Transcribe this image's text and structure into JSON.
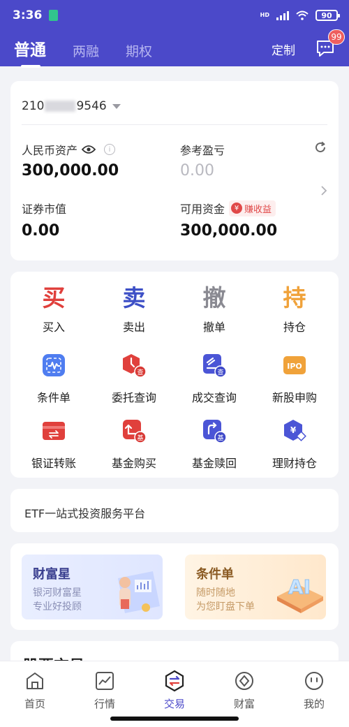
{
  "status_bar": {
    "time": "3:36",
    "network": "HD",
    "battery": "90"
  },
  "header": {
    "tabs": [
      {
        "label": "普通",
        "active": true
      },
      {
        "label": "两融",
        "active": false
      },
      {
        "label": "期权",
        "active": false
      }
    ],
    "customize_label": "定制",
    "message_badge": "99"
  },
  "account": {
    "number_prefix": "210",
    "number_suffix": "9546",
    "rmb_assets_label": "人民币资产",
    "rmb_assets_value": "300,000.00",
    "ref_pnl_label": "参考盈亏",
    "ref_pnl_value": "0.00",
    "securities_value_label": "证券市值",
    "securities_value": "0.00",
    "available_funds_label": "可用资金",
    "available_funds_value": "300,000.00",
    "earn_badge_label": "赚收益",
    "earn_badge_icon": "¥"
  },
  "trade_actions": [
    {
      "char": "买",
      "label": "买入",
      "color": "#e0403c"
    },
    {
      "char": "卖",
      "label": "卖出",
      "color": "#3d4fc6"
    },
    {
      "char": "撤",
      "label": "撤单",
      "color": "#8a8a92"
    },
    {
      "char": "持",
      "label": "持仓",
      "color": "#f0a23a"
    }
  ],
  "functions_row1": [
    {
      "label": "条件单",
      "icon": "waveform-icon"
    },
    {
      "label": "委托查询",
      "icon": "order-query-icon"
    },
    {
      "label": "成交查询",
      "icon": "deal-query-icon"
    },
    {
      "label": "新股申购",
      "icon": "ipo-icon",
      "icon_text": "IPO"
    }
  ],
  "functions_row2": [
    {
      "label": "银证转账",
      "icon": "bank-transfer-icon"
    },
    {
      "label": "基金购买",
      "icon": "fund-buy-icon"
    },
    {
      "label": "基金赎回",
      "icon": "fund-redeem-icon"
    },
    {
      "label": "理财持仓",
      "icon": "wealth-holding-icon",
      "icon_text": "¥"
    }
  ],
  "etf": {
    "text": "ETF一站式投资服务平台"
  },
  "promos": [
    {
      "title": "财富星",
      "line1": "银河财富星",
      "line2": "专业好投顾"
    },
    {
      "title": "条件单",
      "line1": "随时随地",
      "line2": "为您盯盘下单"
    }
  ],
  "partial_section": {
    "title": "股票交易"
  },
  "bottom_nav": [
    {
      "label": "首页",
      "icon": "home-icon",
      "active": false
    },
    {
      "label": "行情",
      "icon": "chart-icon",
      "active": false
    },
    {
      "label": "交易",
      "icon": "trade-icon",
      "active": true
    },
    {
      "label": "财富",
      "icon": "wealth-icon",
      "active": false
    },
    {
      "label": "我的",
      "icon": "profile-icon",
      "active": false
    }
  ],
  "colors": {
    "brand": "#4b49c9",
    "badge": "#ee5e5e"
  }
}
